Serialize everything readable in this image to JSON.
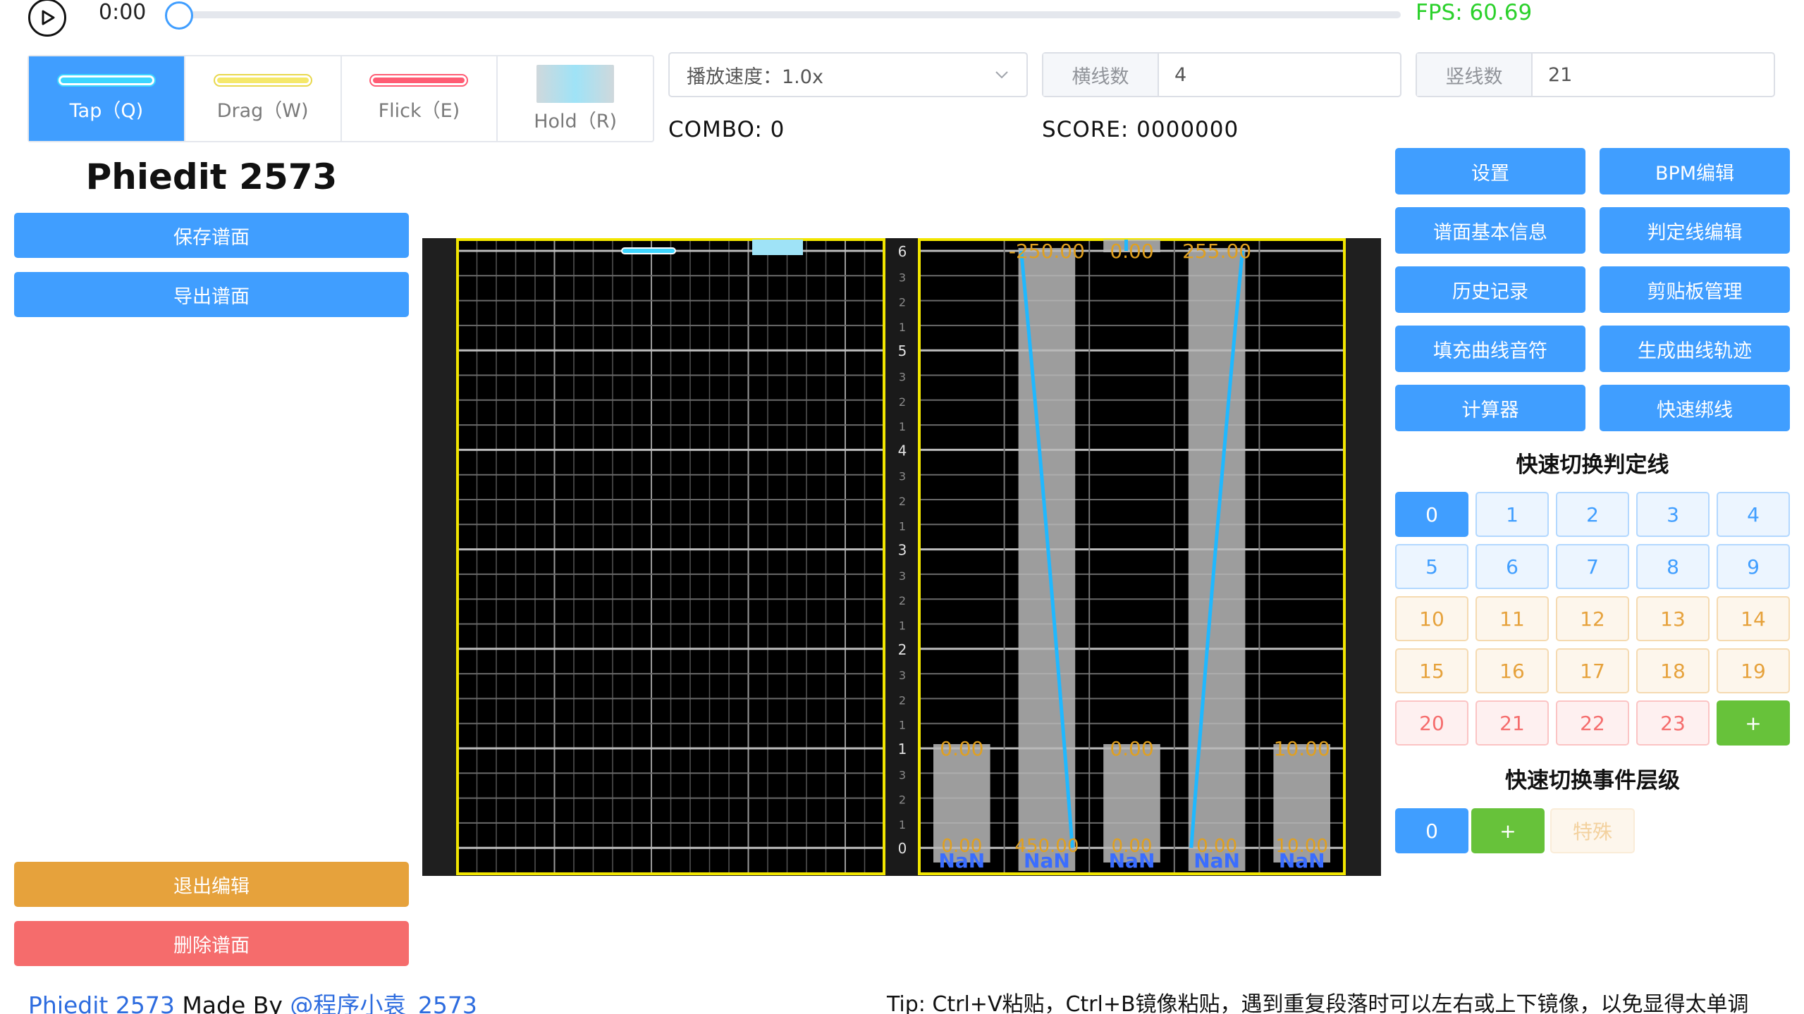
{
  "player": {
    "time": "0:00",
    "progress": 0,
    "fps": "FPS: 60.69"
  },
  "note_types": [
    {
      "label": "Tap（Q)",
      "active": true
    },
    {
      "label": "Drag（W)",
      "active": false
    },
    {
      "label": "Flick（E)",
      "active": false
    },
    {
      "label": "Hold（R)",
      "active": false
    }
  ],
  "controls": {
    "speed_label": "播放速度：1.0x",
    "hlines_label": "横线数",
    "hlines_value": "4",
    "vlines_label": "竖线数",
    "vlines_value": "21",
    "combo": "COMBO: 0",
    "score": "SCORE: 0000000"
  },
  "sidebar": {
    "title": "Phiedit 2573",
    "save": "保存谱面",
    "export": "导出谱面",
    "exit": "退出编辑",
    "delete": "删除谱面"
  },
  "editor": {
    "beat_labels": [
      "6",
      "3",
      "2",
      "1",
      "5",
      "3",
      "2",
      "1",
      "4",
      "3",
      "2",
      "1",
      "3",
      "3",
      "2",
      "1",
      "2",
      "3",
      "2",
      "1",
      "1",
      "3",
      "2",
      "1",
      "0"
    ],
    "event_top_values": [
      "-250.00",
      "0.00",
      "255.00"
    ],
    "event_mid_values": [
      "0.00",
      "0.00",
      "10.00"
    ],
    "event_bottom_values": [
      "0.00",
      "450.00",
      "0.00",
      "0.00",
      "10.00"
    ],
    "nan_labels": [
      "NaN",
      "NaN",
      "NaN",
      "NaN",
      "NaN"
    ]
  },
  "tools": [
    "设置",
    "BPM编辑",
    "谱面基本信息",
    "判定线编辑",
    "历史记录",
    "剪贴板管理",
    "填充曲线音符",
    "生成曲线轨迹",
    "计算器",
    "快速绑线"
  ],
  "quick_line": {
    "title": "快速切换判定线",
    "buttons": [
      "0",
      "1",
      "2",
      "3",
      "4",
      "5",
      "6",
      "7",
      "8",
      "9",
      "10",
      "11",
      "12",
      "13",
      "14",
      "15",
      "16",
      "17",
      "18",
      "19",
      "20",
      "21",
      "22",
      "23",
      "+"
    ]
  },
  "quick_layer": {
    "title": "快速切换事件层级",
    "zero": "0",
    "add": "+",
    "special": "特殊"
  },
  "footer": {
    "app_name": "Phiedit 2573",
    "made_by": " Made By ",
    "author": "@程序小袁_2573",
    "tip": "Tip: Ctrl+V粘贴，Ctrl+B镜像粘贴，遇到重复段落时可以左右或上下镜像，以免显得太单调"
  },
  "colors": {
    "primary": "#409eff",
    "fps": "#2bd12b",
    "warning": "#e6a23c",
    "danger": "#f56c6c",
    "success": "#67c23a",
    "editor_border": "#f2e600",
    "event_value": "#e0a020",
    "speed_curve": "#20b8ff"
  }
}
